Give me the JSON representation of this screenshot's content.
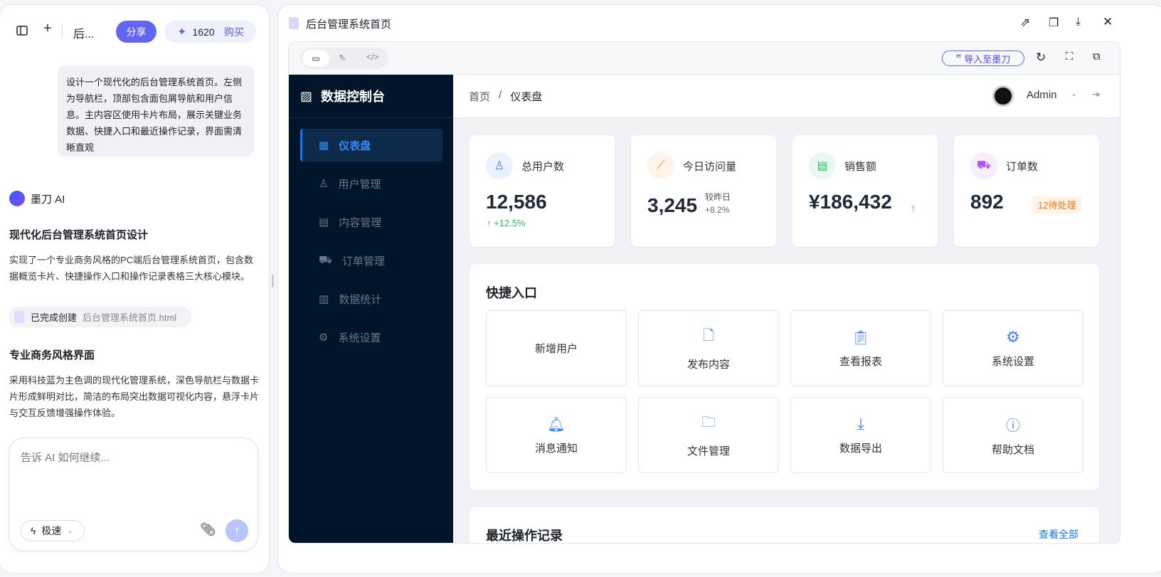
{
  "left_panel": {
    "title": "后...",
    "share": "分享",
    "credits": "1620",
    "buy": "购买",
    "user_message": "设计一个现代化的后台管理系统首页。左侧为导航栏，顶部包含面包屑导航和用户信息。主内容区使用卡片布局，展示关键业务数据、快捷入口和最近操作记录，界面需清晰直观",
    "ai_name": "墨刀 AI",
    "h1": "现代化后台管理系统首页设计",
    "p1": "实现了一个专业商务风格的PC端后台管理系统首页，包含数据概览卡片、快捷操作入口和操作记录表格三大核心模块。",
    "chip_status": "已完成创建",
    "chip_file": "后台管理系统首页.html",
    "h2": "专业商务风格界面",
    "p2": "采用科技蓝为主色调的现代化管理系统，深色导航栏与数据卡片形成鲜明对比，简洁的布局突出数据可视化内容，悬浮卡片与交互反馈增强操作体验。",
    "input_placeholder": "告诉 AI 如何继续...",
    "mode": "极速"
  },
  "preview": {
    "title": "后台管理系统首页",
    "import": "导入至墨刀",
    "app": {
      "brand": "数据控制台",
      "nav": [
        {
          "label": "仪表盘",
          "icon": "dashboard-icon",
          "active": true
        },
        {
          "label": "用户管理",
          "icon": "user-icon"
        },
        {
          "label": "内容管理",
          "icon": "document-icon"
        },
        {
          "label": "订单管理",
          "icon": "cart-icon"
        },
        {
          "label": "数据统计",
          "icon": "bar-chart-icon"
        },
        {
          "label": "系统设置",
          "icon": "gear-icon"
        }
      ],
      "breadcrumb": [
        "首页",
        "仪表盘"
      ],
      "user": "Admin",
      "stats": [
        {
          "label": "总用户数",
          "value": "12,586",
          "change": "↑ +12.5%"
        },
        {
          "label": "今日访问量",
          "value": "3,245",
          "note": "较昨日",
          "change": "+8.2%"
        },
        {
          "label": "销售额",
          "value": "¥186,432",
          "change": "↑"
        },
        {
          "label": "订单数",
          "value": "892",
          "badge": "12待处理"
        }
      ],
      "quick_title": "快捷入口",
      "quick": [
        "新增用户",
        "发布内容",
        "查看报表",
        "系统设置",
        "消息通知",
        "文件管理",
        "数据导出",
        "帮助文档"
      ],
      "recent_title": "最近操作记录",
      "view_all": "查看全部"
    }
  },
  "colors": {
    "accent": "#6366f1",
    "primary": "#1677ff",
    "sidebar": "#001529"
  }
}
